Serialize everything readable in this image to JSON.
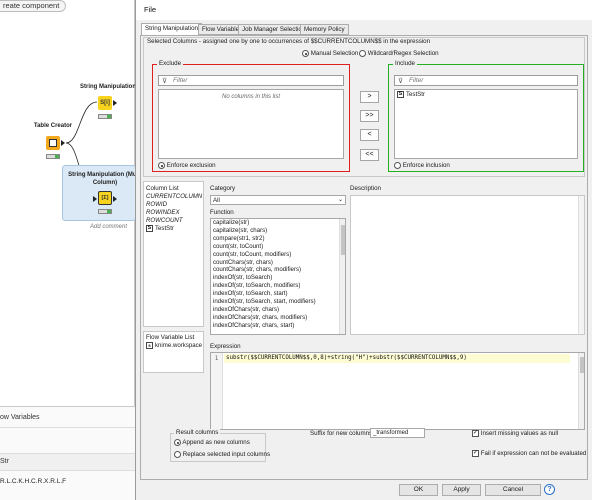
{
  "workflow": {
    "create_button": "reate component",
    "nodes": {
      "string_manip_top": "String Manipulation",
      "table_creator": "Table Creator",
      "string_manip_multi": "String Manipulation (Multi Column)",
      "add_comment": "Add comment"
    },
    "bottom": {
      "flow_variables": "ow Variables",
      "column_header": "Str",
      "value": "R.L.C.K.H.C.R.X.R.L.F"
    }
  },
  "dialog": {
    "title": "File",
    "tabs": [
      "String Manipulation",
      "Flow Variables",
      "Job Manager Selection",
      "Memory Policy"
    ],
    "selected_columns_label": "Selected Columns - assigned one by one to occurrences of $$CURRENTCOLUMN$$ in the expression",
    "manual_selection": "Manual Selection",
    "wildcard_selection": "Wildcard/Regex Selection",
    "exclude": {
      "title": "Exclude",
      "filter_placeholder": "Filter",
      "empty_text": "No columns in this list",
      "enforce": "Enforce exclusion"
    },
    "include": {
      "title": "Include",
      "filter_placeholder": "Filter",
      "items": [
        "TestStr"
      ],
      "enforce": "Enforce inclusion"
    },
    "move_buttons": [
      ">",
      ">>",
      "<",
      "<<"
    ],
    "column_list": {
      "title": "Column List",
      "items": [
        "CURRENTCOLUMN",
        "ROWID",
        "ROWINDEX",
        "ROWCOUNT",
        "TestStr"
      ]
    },
    "category": {
      "label": "Category",
      "value": "All"
    },
    "function": {
      "label": "Function",
      "items": [
        "capitalize(str)",
        "capitalize(str, chars)",
        "compare(str1, str2)",
        "count(str, toCount)",
        "count(str, toCount, modifiers)",
        "countChars(str, chars)",
        "countChars(str, chars, modifiers)",
        "indexOf(str, toSearch)",
        "indexOf(str, toSearch, modifiers)",
        "indexOf(str, toSearch, start)",
        "indexOf(str, toSearch, start, modifiers)",
        "indexOfChars(str, chars)",
        "indexOfChars(str, chars, modifiers)",
        "indexOfChars(str, chars, start)"
      ]
    },
    "description": {
      "label": "Description"
    },
    "flow_variable_list": {
      "title": "Flow Variable List",
      "items": [
        "knime.workspace"
      ]
    },
    "expression": {
      "label": "Expression",
      "line_number": "1",
      "text": "substr($$CURRENTCOLUMN$$,0,8)+string(\"H\")+substr($$CURRENTCOLUMN$$,9)"
    },
    "result_columns": {
      "title": "Result columns",
      "append": "Append as new columns",
      "replace": "Replace selected input columns"
    },
    "suffix": {
      "label": "Suffix for new columns",
      "value": "_transformed"
    },
    "insert_missing": "Insert missing values as null",
    "fail_if_error": "Fail if expression can not be evaluated",
    "buttons": {
      "ok": "OK",
      "apply": "Apply",
      "cancel": "Cancel"
    },
    "colors": {
      "exclude_border": "#e02020",
      "include_border": "#22b022",
      "node_orange": "#f3a81e",
      "node_yellow": "#f8d31d"
    }
  }
}
